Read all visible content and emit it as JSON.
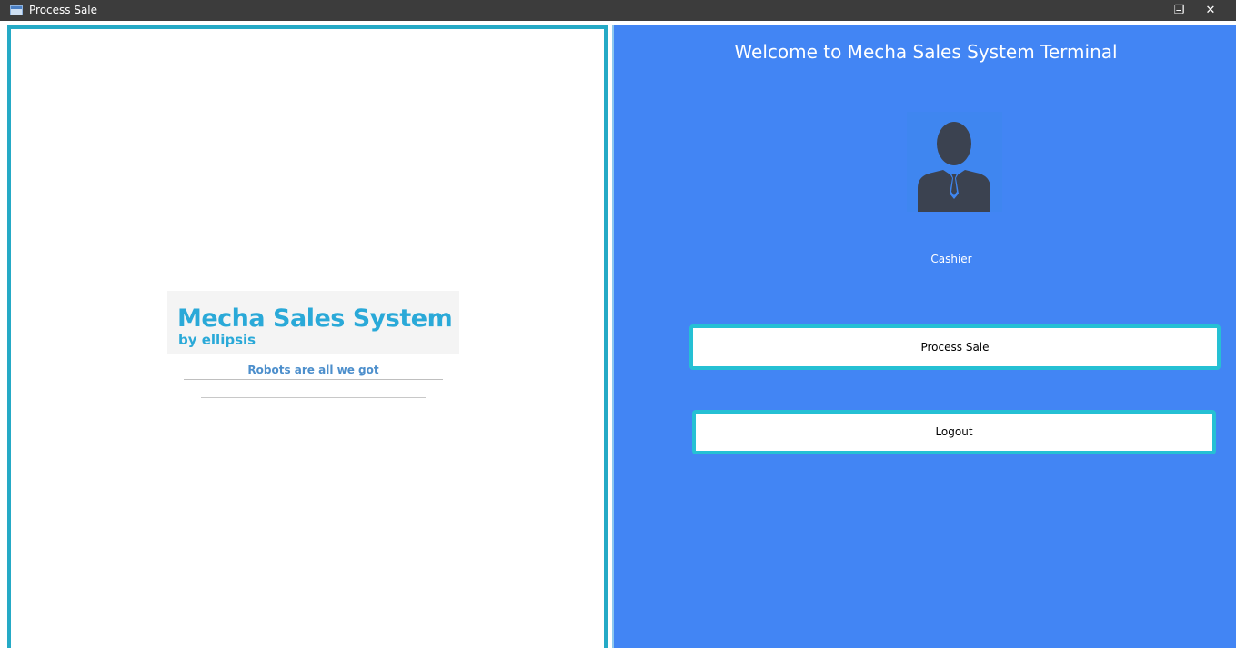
{
  "window": {
    "title": "Process Sale",
    "minimize_glyph": "–",
    "restore_glyph": "❐",
    "close_glyph": "✕"
  },
  "branding": {
    "logo_main": "Mecha Sales System",
    "logo_sub": "by ellipsis",
    "tagline": "Robots are all we got",
    "logo_color": "#2aa9d8"
  },
  "terminal": {
    "welcome": "Welcome to Mecha Sales System Terminal",
    "user_icon": "user-icon",
    "role": "Cashier",
    "process_sale_label": "Process Sale",
    "logout_label": "Logout"
  },
  "colors": {
    "panel_bg": "#4285f4",
    "border_accent": "#25aac6",
    "button_border": "#25c0d4",
    "titlebar_bg": "#3c3c3c"
  }
}
